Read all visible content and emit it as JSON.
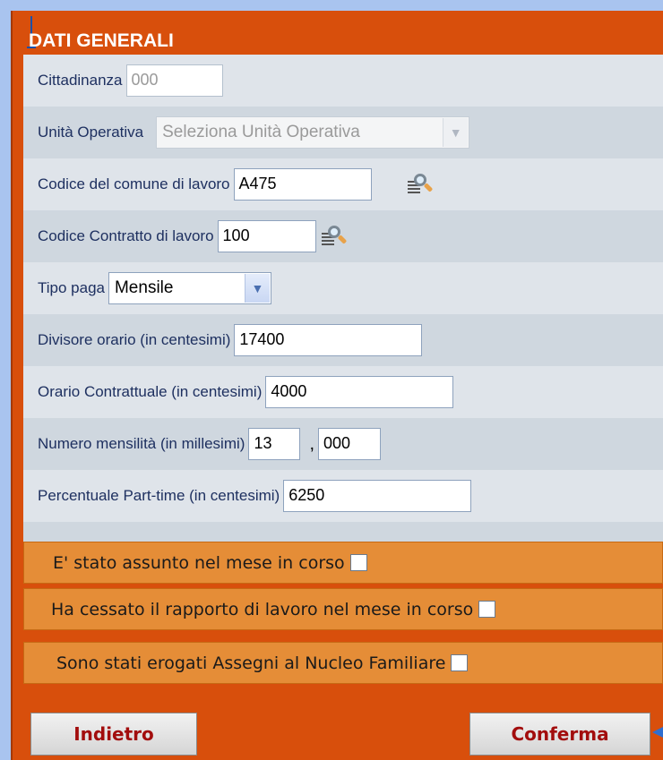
{
  "section_title": "DATI GENERALI",
  "fields": {
    "cittadinanza": {
      "label": "Cittadinanza",
      "value": "000"
    },
    "unita_operativa": {
      "label": "Unità Operativa",
      "selected": "Seleziona Unità Operativa"
    },
    "codice_comune": {
      "label": "Codice del comune di lavoro",
      "value": "A475"
    },
    "codice_contratto": {
      "label": "Codice Contratto di lavoro",
      "value": "100"
    },
    "tipo_paga": {
      "label": "Tipo paga",
      "selected": "Mensile"
    },
    "divisore_orario": {
      "label": "Divisore orario (in centesimi)",
      "value": "17400"
    },
    "orario_contrattuale": {
      "label": "Orario Contrattuale (in centesimi)",
      "value": "4000"
    },
    "numero_mensilita": {
      "label": "Numero mensilità (in millesimi)",
      "value_int": "13",
      "separator": ",",
      "value_dec": "000"
    },
    "percentuale_part_time": {
      "label": "Percentuale Part-time (in centesimi)",
      "value": "6250"
    }
  },
  "checkbox_rows": {
    "assunto": {
      "label": "E' stato assunto nel mese in corso",
      "checked": false
    },
    "cessato": {
      "label": "Ha cessato il rapporto di lavoro nel mese in corso",
      "checked": false
    },
    "assegni": {
      "label": "Sono stati erogati Assegni al Nucleo Familiare",
      "checked": false
    }
  },
  "buttons": {
    "back": "Indietro",
    "confirm": "Conferma"
  },
  "colors": {
    "panel_bg": "#d84f0c",
    "form_bg": "#dfe4ea",
    "form_alt_bg": "#cfd7df",
    "checkbox_bar_bg": "#e58d37",
    "label_text": "#1e3060",
    "button_text": "#a20d0d",
    "page_bg": "#a9c4ef"
  },
  "icons": {
    "lookup": "magnifier-lookup-icon",
    "dropdown": "chevron-down-icon"
  }
}
